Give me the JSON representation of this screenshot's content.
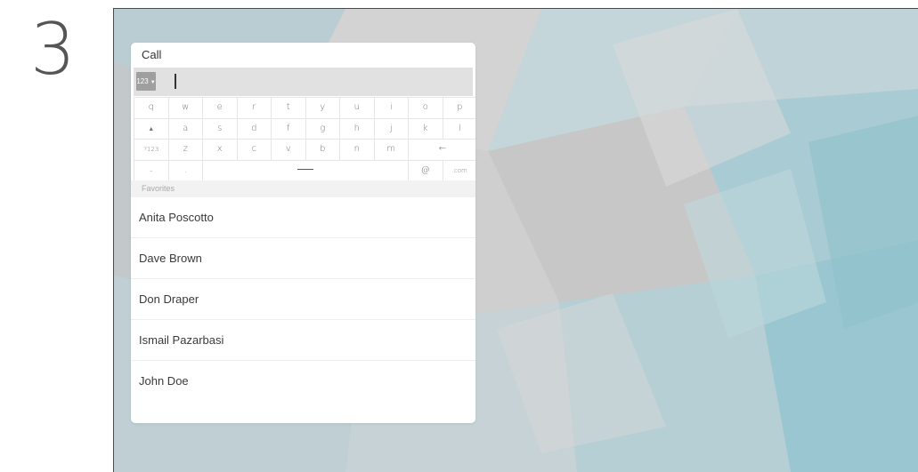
{
  "step": {
    "number": "3"
  },
  "call": {
    "title": "Call",
    "input_mode": "123",
    "input_value": ""
  },
  "keyboard": {
    "rows": [
      [
        "q",
        "w",
        "e",
        "r",
        "t",
        "y",
        "u",
        "i",
        "o",
        "p"
      ],
      [
        "▲",
        "a",
        "s",
        "d",
        "f",
        "g",
        "h",
        "j",
        "k",
        "l"
      ],
      [
        "?123",
        "z",
        "x",
        "c",
        "v",
        "b",
        "n",
        "m",
        "←"
      ],
      [
        "–",
        ".",
        "",
        "@",
        ".com"
      ]
    ]
  },
  "favorites": {
    "header": "Favorites",
    "contacts": [
      "Anita Poscotto",
      "Dave Brown",
      "Don Draper",
      "Ismail Pazarbasi",
      "John Doe"
    ]
  },
  "colors": {
    "background_base": "#c9c9c9",
    "accent_teal": "#7fb6c4",
    "panel": "#ffffff"
  }
}
